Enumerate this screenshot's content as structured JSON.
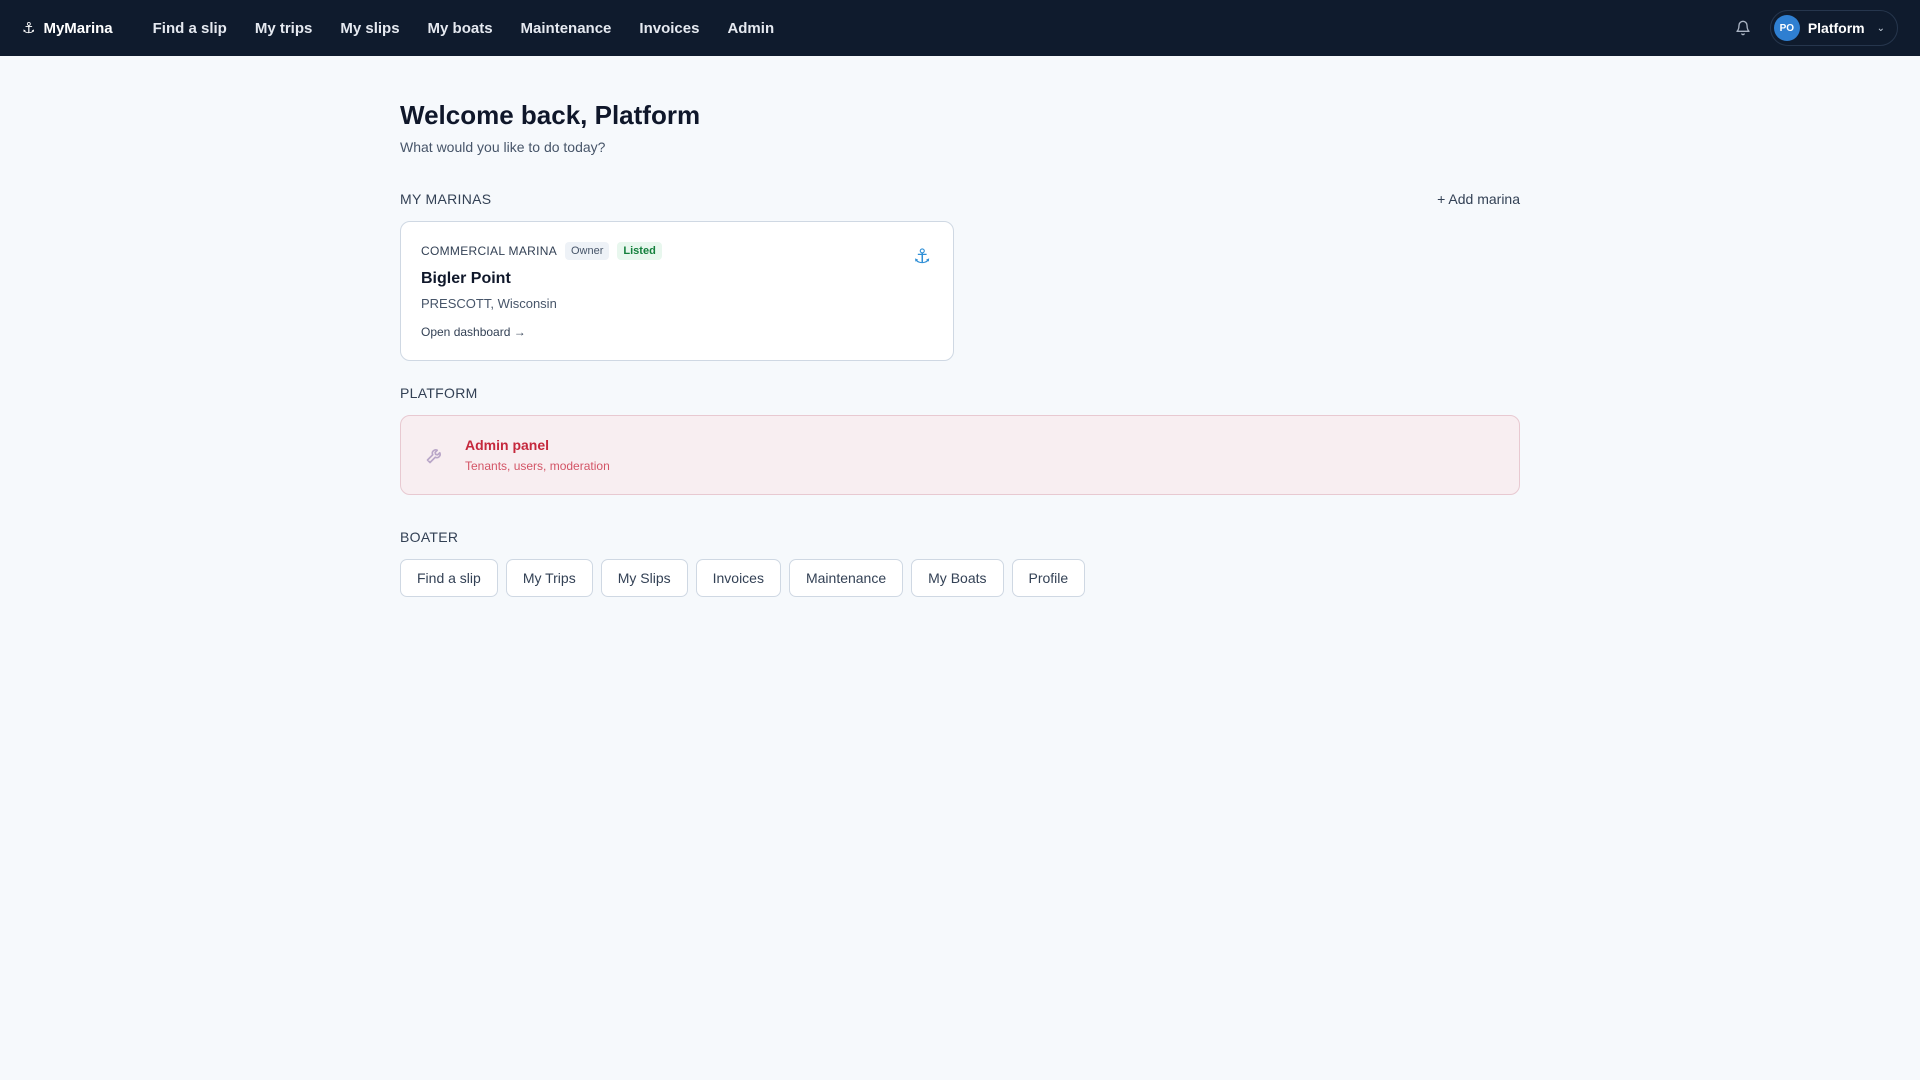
{
  "brand": {
    "name": "MyMarina",
    "icon": "anchor-icon"
  },
  "nav": {
    "items": [
      "Find a slip",
      "My trips",
      "My slips",
      "My boats",
      "Maintenance",
      "Invoices",
      "Admin"
    ]
  },
  "user": {
    "initials": "PO",
    "name": "Platform"
  },
  "welcome": {
    "title": "Welcome back, Platform",
    "subtitle": "What would you like to do today?"
  },
  "marinas": {
    "section_title": "MY MARINAS",
    "add_label": "+ Add marina",
    "card": {
      "type": "COMMERCIAL MARINA",
      "role": "Owner",
      "status": "Listed",
      "name": "Bigler Point",
      "location": "PRESCOTT, Wisconsin",
      "link": "Open dashboard →"
    }
  },
  "platform": {
    "section_title": "PLATFORM",
    "admin": {
      "title": "Admin panel",
      "subtitle": "Tenants, users, moderation"
    }
  },
  "boater": {
    "section_title": "BOATER",
    "chips": [
      "Find a slip",
      "My Trips",
      "My Slips",
      "Invoices",
      "Maintenance",
      "My Boats",
      "Profile"
    ]
  },
  "colors": {
    "topbar": "#0f1b2d",
    "accent": "#2f8fd6",
    "admin_red": "#c5283d",
    "listed_green": "#15803d"
  }
}
